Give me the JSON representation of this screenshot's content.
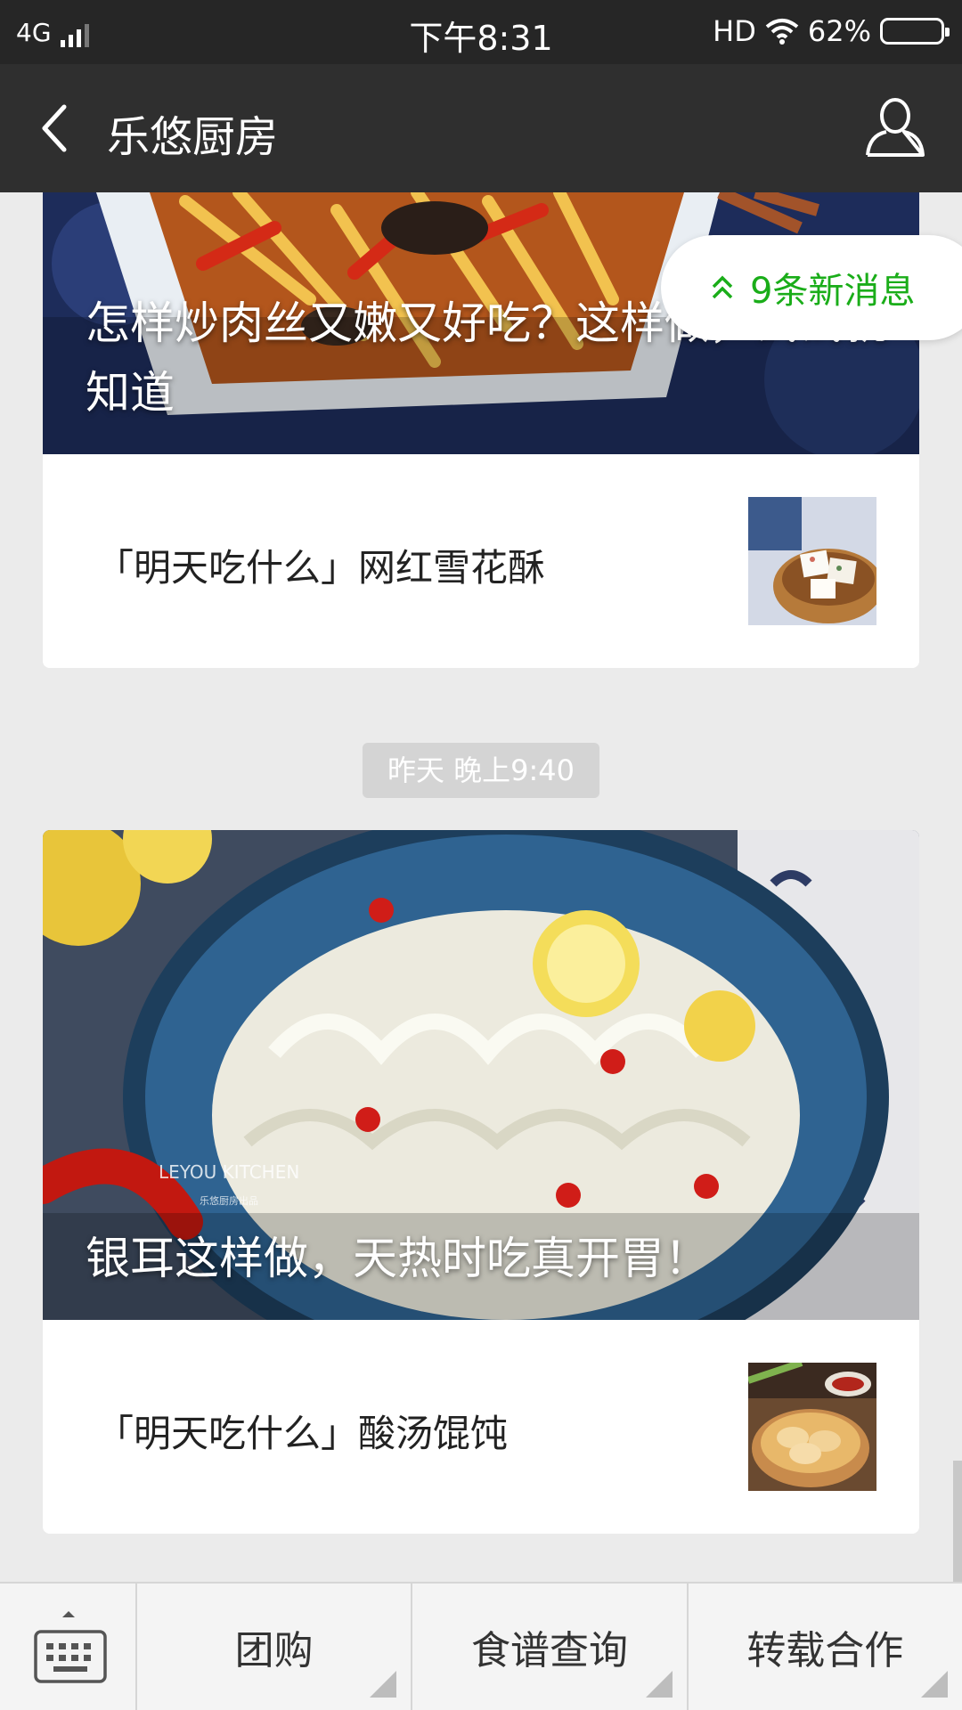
{
  "status_bar": {
    "network": "4G",
    "time": "下午8:31",
    "hd": "HD",
    "battery": "62%",
    "battery_color": "#f0506e"
  },
  "header": {
    "title": "乐悠厨房",
    "back_icon": "chevron-left-icon",
    "profile_icon": "person-icon"
  },
  "messages": [
    {
      "cover_title": "怎样炒肉丝又嫩又好吃？这样做，试试就知道",
      "items": [
        {
          "title": "「明天吃什么」网红雪花酥"
        }
      ]
    },
    {
      "timestamp": "昨天 晚上9:40",
      "cover_title": "银耳这样做，天热时吃真开胃！",
      "watermark": "LEYOU KITCHEN",
      "watermark_sub": "乐悠厨房出品",
      "items": [
        {
          "title": "「明天吃什么」酸汤馄饨"
        }
      ]
    }
  ],
  "new_messages": {
    "label": "9条新消息",
    "color": "#1aad19"
  },
  "bottom_menu": {
    "keyboard_icon": "keyboard-icon",
    "items": [
      {
        "label": "团购"
      },
      {
        "label": "食谱查询"
      },
      {
        "label": "转载合作"
      }
    ]
  }
}
